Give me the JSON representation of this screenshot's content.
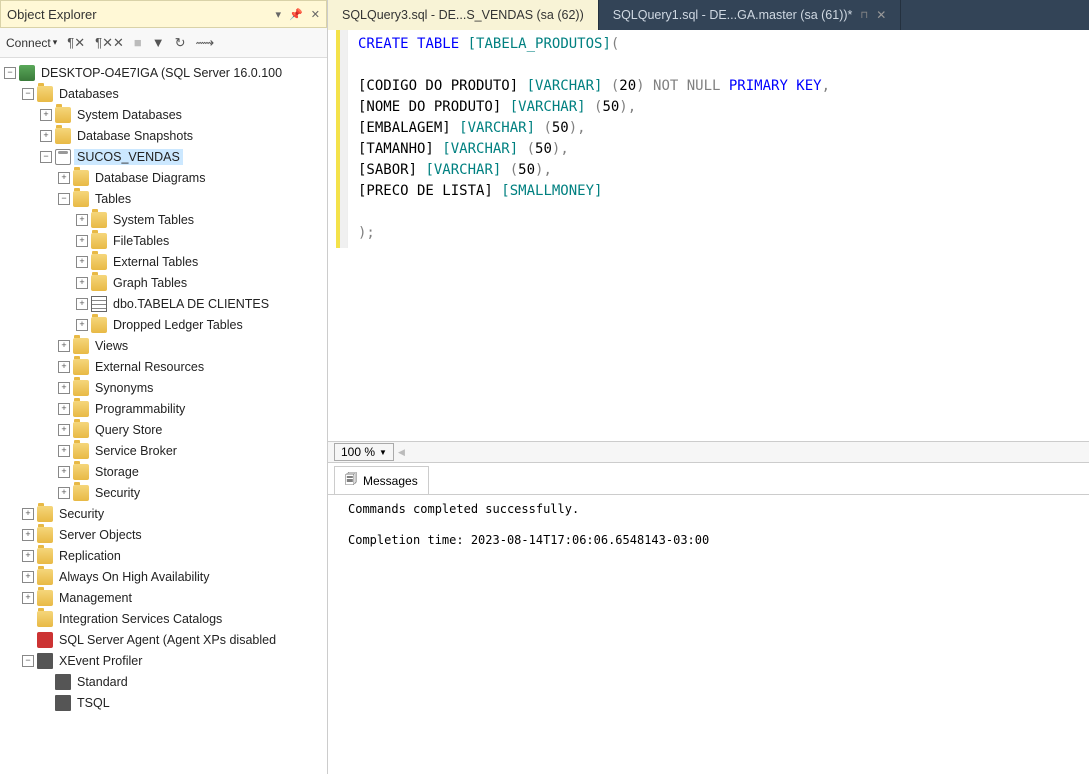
{
  "panel": {
    "title": "Object Explorer",
    "connect": "Connect"
  },
  "tree": {
    "server": "DESKTOP-O4E7IGA (SQL Server 16.0.100",
    "databases": "Databases",
    "sysdb": "System Databases",
    "snap": "Database Snapshots",
    "sucos": "SUCOS_VENDAS",
    "diagrams": "Database Diagrams",
    "tables": "Tables",
    "systables": "System Tables",
    "filetables": "FileTables",
    "exttables": "External Tables",
    "graphtables": "Graph Tables",
    "dbo_clientes": "dbo.TABELA DE CLIENTES",
    "dropped": "Dropped Ledger Tables",
    "views": "Views",
    "extres": "External Resources",
    "synonyms": "Synonyms",
    "prog": "Programmability",
    "qstore": "Query Store",
    "sbroker": "Service Broker",
    "storage": "Storage",
    "security_db": "Security",
    "security_srv": "Security",
    "srvobj": "Server Objects",
    "replication": "Replication",
    "alwayson": "Always On High Availability",
    "management": "Management",
    "iscs": "Integration Services Catalogs",
    "agent": "SQL Server Agent (Agent XPs disabled",
    "xevent": "XEvent Profiler",
    "standard": "Standard",
    "tsql": "TSQL"
  },
  "tabs": {
    "t1": "SQLQuery3.sql - DE...S_VENDAS (sa (62))",
    "t2": "SQLQuery1.sql - DE...GA.master (sa (61))*"
  },
  "sql": {
    "create": "CREATE",
    "table": "TABLE",
    "tname": "[TABELA_PRODUTOS]",
    "l1a": "[CODIGO DO PRODUTO] ",
    "l1b": "[VARCHAR]",
    "l1c": " (",
    "l1d": "20",
    "l1e": ")",
    "l1f": " NOT NULL",
    "l1g": " PRIMARY KEY",
    "l1h": ",",
    "l2a": "[NOME DO PRODUTO] ",
    "l2b": "[VARCHAR]",
    "l2c": " (",
    "l2d": "50",
    "l2e": ")",
    "l2f": ",",
    "l3a": "[EMBALAGEM] ",
    "l3b": "[VARCHAR]",
    "l3c": " (",
    "l3d": "50",
    "l3e": ")",
    "l3f": ",",
    "l4a": "[TAMANHO] ",
    "l4b": "[VARCHAR]",
    "l4c": " (",
    "l4d": "50",
    "l4e": ")",
    "l4f": ",",
    "l5a": "[SABOR] ",
    "l5b": "[VARCHAR]",
    "l5c": " (",
    "l5d": "50",
    "l5e": ")",
    "l5f": ",",
    "l6a": "[PRECO DE LISTA] ",
    "l6b": "[SMALLMONEY]",
    "end": ");"
  },
  "zoom": "100 %",
  "messages": {
    "tab": "Messages",
    "line1": "Commands completed successfully.",
    "line2": "Completion time: 2023-08-14T17:06:06.6548143-03:00"
  }
}
